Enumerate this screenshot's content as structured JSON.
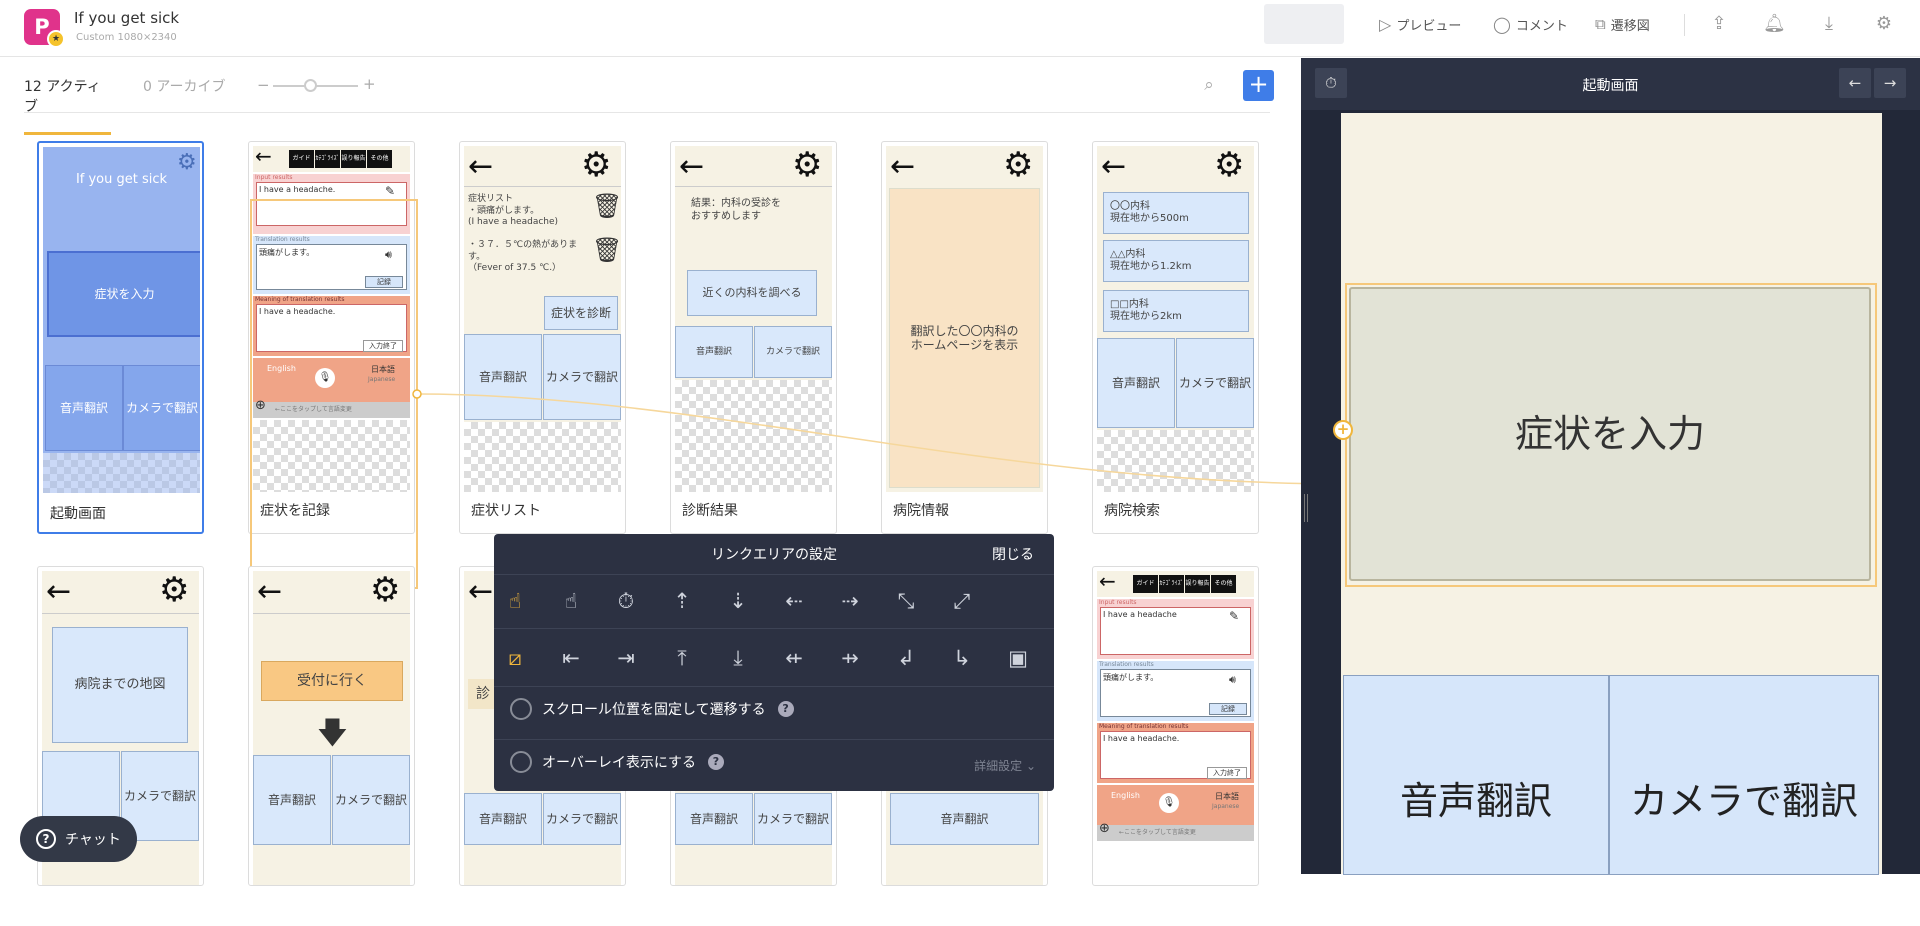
{
  "header": {
    "app_logo": "P",
    "project_title": "If you get sick",
    "project_meta": "Custom 1080×2340",
    "preview": "プレビュー",
    "comment": "コメント",
    "transition": "遷移図"
  },
  "tabs": {
    "active": "12 アクティブ",
    "archive": "0 アーカイブ"
  },
  "screens": {
    "s1": {
      "label": "起動画面",
      "title": "If you get sick",
      "btn": "症状を入力",
      "b1": "音声翻訳",
      "b2": "カメラで翻訳"
    },
    "s2": {
      "label": "症状を記録",
      "tabs": [
        "ガイド",
        "ｶﾃｺﾞﾗｲｽﾞ",
        "誤り報告",
        "その他"
      ],
      "input_lbl": "Input results",
      "input": "I have a headache.",
      "trans_lbl": "Translation results",
      "trans": "頭痛がします。",
      "rec": "記録",
      "mean_lbl": "Meaning of translation results",
      "mean": "I have a headache.",
      "end": "入力終了",
      "lang1": "English",
      "lang2": "日本語",
      "lang2s": "Japanese",
      "hint": "←ここをタップして言語変更"
    },
    "s3": {
      "label": "症状リスト",
      "list": "症状リスト\n・頭痛がします。\n(I have a headache)",
      "fever": "・３７．５℃の熱があります。\n（Fever of 37.5 ℃.）",
      "diag": "症状を診断",
      "b1": "音声翻訳",
      "b2": "カメラで翻訳"
    },
    "s4": {
      "label": "診断結果",
      "result": "結果：内科の受診を\nおすすめします",
      "search": "近くの内科を調べる",
      "b1": "音声翻訳",
      "b2": "カメラで翻訳"
    },
    "s5": {
      "label": "病院情報",
      "text": "翻訳した〇〇内科の\nホームページを表示"
    },
    "s6": {
      "label": "病院検索",
      "h1": "〇〇内科\n現在地から500m",
      "h2": "△△内科\n現在地から1.2km",
      "h3": "□□内科\n現在地から2km",
      "b1": "音声翻訳",
      "b2": "カメラで翻訳"
    },
    "r2a": {
      "map": "病院までの地図",
      "b2": "カメラで翻訳"
    },
    "r2b": {
      "reception": "受付に行く",
      "b1": "音声翻訳",
      "b2": "カメラで翻訳"
    },
    "r2c": {
      "peek": "診",
      "b1": "音声翻訳",
      "b2": "カメラで翻訳"
    },
    "r2d": {
      "b1": "音声翻訳",
      "b2": "カメラで翻訳"
    },
    "r2e": {
      "b1": "音声翻訳"
    },
    "r2f": {
      "tabs": [
        "ガイド",
        "ｶﾃｺﾞﾗｲｽﾞ",
        "誤り報告",
        "その他"
      ],
      "input_lbl": "Input results",
      "input": "I have a headache",
      "trans_lbl": "Translation results",
      "trans": "頭痛がします。",
      "rec": "記録",
      "mean_lbl": "Meaning of translation results",
      "mean": "I have a headache.",
      "end": "入力終了",
      "lang1": "English",
      "lang2": "日本語",
      "lang2s": "Japanese",
      "hint": "←ここをタップして言語変更"
    }
  },
  "dialog": {
    "title": "リンクエリアの設定",
    "close": "閉じる",
    "scroll_fix": "スクロール位置を固定して遷移する",
    "overlay": "オーバーレイ表示にする",
    "advanced": "詳細設定"
  },
  "right_panel": {
    "title": "起動画面",
    "big_button": "症状を入力",
    "b1": "音声翻訳",
    "b2": "カメラで翻訳"
  },
  "chat": {
    "label": "チャット"
  },
  "colors": {
    "accent": "#3f7de8",
    "highlight": "#f0b63c",
    "panel_bg": "#222838",
    "screen_bg": "#f6f2e4",
    "tile_blue": "#d9e8fb"
  }
}
